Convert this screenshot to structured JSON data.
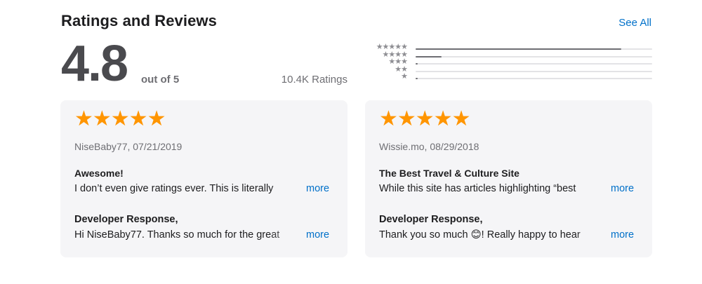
{
  "section": {
    "title": "Ratings and Reviews",
    "see_all": "See All"
  },
  "summary": {
    "rating": "4.8",
    "out_of": "out of 5",
    "count": "10.4K Ratings"
  },
  "histogram": [
    {
      "stars": "★★★★★",
      "fraction": 0.87
    },
    {
      "stars": "★★★★",
      "fraction": 0.11
    },
    {
      "stars": "★★★",
      "fraction": 0.01
    },
    {
      "stars": "★★",
      "fraction": 0.0
    },
    {
      "stars": "★",
      "fraction": 0.01
    }
  ],
  "reviews": [
    {
      "stars": "★★★★★",
      "meta": "NiseBaby77, 07/21/2019",
      "title": "Awesome!",
      "body": "I don’t even give ratings ever. This is literally",
      "more": "more",
      "response_title": "Developer Response,",
      "response_body": "Hi NiseBaby77. Thanks so much for the great",
      "response_more": "more"
    },
    {
      "stars": "★★★★★",
      "meta": "Wissie.mo, 08/29/2018",
      "title": "The Best Travel & Culture Site",
      "body": "While this site has articles highlighting “best",
      "more": "more",
      "response_title": "Developer Response,",
      "response_body": "Thank you so much 😊! Really happy to hear",
      "response_more": "more"
    }
  ],
  "colors": {
    "accent": "#0070c9",
    "star": "#ff9500",
    "card_bg": "#f5f5f7"
  }
}
